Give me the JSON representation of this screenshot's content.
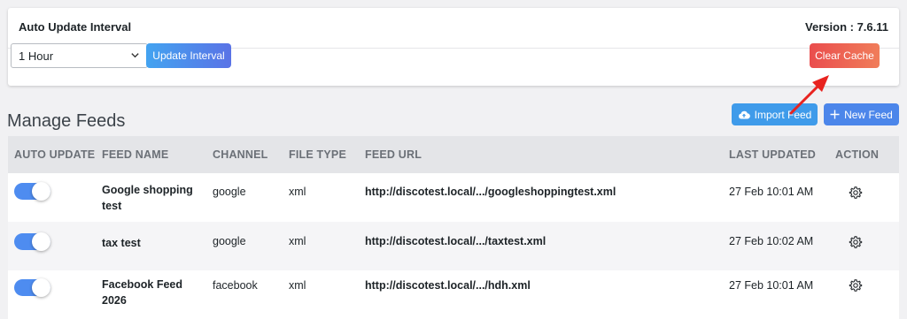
{
  "settings": {
    "title": "Auto Update Interval",
    "version": "Version : 7.6.11",
    "interval_selected": "1 Hour",
    "update_button": "Update Interval",
    "clear_cache_button": "Clear Cache"
  },
  "feeds": {
    "title": "Manage Feeds",
    "import_button": "Import Feed",
    "new_button": "New Feed",
    "columns": [
      "AUTO UPDATE",
      "FEED NAME",
      "CHANNEL",
      "FILE TYPE",
      "FEED URL",
      "LAST UPDATED",
      "ACTION"
    ],
    "rows": [
      {
        "name_line1": "Google shopping",
        "name_line2": "test",
        "channel": "google",
        "file_type": "xml",
        "url": "http://discotest.local/.../googleshoppingtest.xml",
        "last_updated": "27 Feb 10:01 AM",
        "auto_update": true
      },
      {
        "name_line1": "tax test",
        "name_line2": "",
        "channel": "google",
        "file_type": "xml",
        "url": "http://discotest.local/.../taxtest.xml",
        "last_updated": "27 Feb 10:02 AM",
        "auto_update": true
      },
      {
        "name_line1": "Facebook Feed",
        "name_line2": "2026",
        "channel": "facebook",
        "file_type": "xml",
        "url": "http://discotest.local/.../hdh.xml",
        "last_updated": "27 Feb 10:01 AM",
        "auto_update": true
      }
    ]
  },
  "icons": {
    "import": "cloud-upload-icon",
    "new": "plus-icon",
    "action": "gear-icon",
    "select": "chevron-down-icon"
  },
  "colors": {
    "primary_blue": "#4c86ea",
    "clear_red": "#ea4d4d",
    "toggle_on": "#4e8cf0",
    "annotation_arrow": "#e8231f"
  }
}
